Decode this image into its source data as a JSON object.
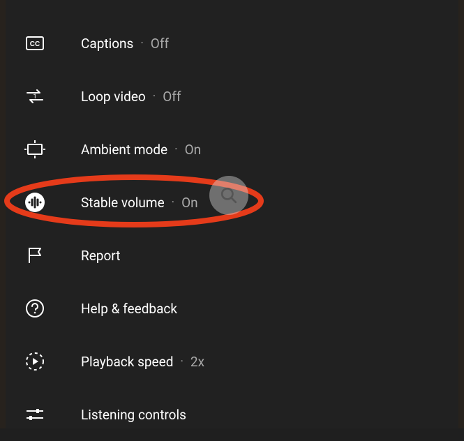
{
  "menu": {
    "captions": {
      "label": "Captions",
      "status": "Off"
    },
    "loop": {
      "label": "Loop video",
      "status": "Off"
    },
    "ambient": {
      "label": "Ambient mode",
      "status": "On"
    },
    "stable": {
      "label": "Stable volume",
      "status": "On"
    },
    "report": {
      "label": "Report"
    },
    "help": {
      "label": "Help & feedback"
    },
    "playback": {
      "label": "Playback speed",
      "status": "2x"
    },
    "listening": {
      "label": "Listening controls"
    }
  },
  "annotation": {
    "highlight_color": "#e53b1a"
  }
}
